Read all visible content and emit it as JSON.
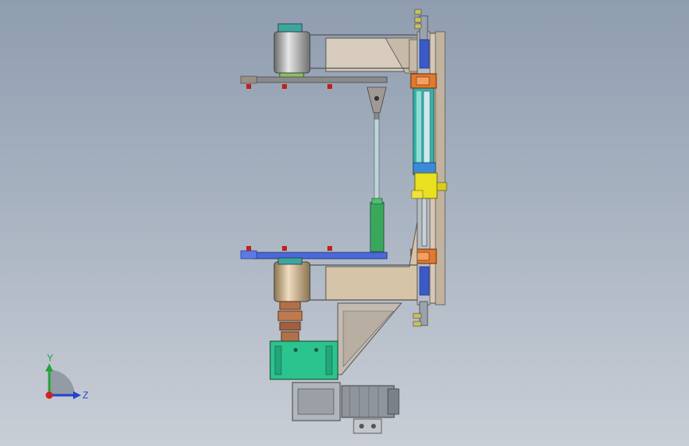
{
  "view": {
    "background_top": "#8f9db0",
    "background_bottom": "#c9ced6"
  },
  "triad": {
    "y_label": "Y",
    "z_label": "Z",
    "y_color": "#22a33a",
    "z_color": "#2346c8",
    "x_color": "#d02020"
  },
  "model": {
    "steel_color": "#d8c8b0",
    "motor_color": "#9aa0a6",
    "gearbox_color": "#2cc48e",
    "bearing_color": "#e07a30",
    "cylinder_color": "#3ab0a8",
    "green_rod_color": "#3aa85a",
    "blue_plate_color": "#4a6ad8",
    "bolt_color": "#c02020",
    "yellow_clamp_color": "#e8e020"
  }
}
